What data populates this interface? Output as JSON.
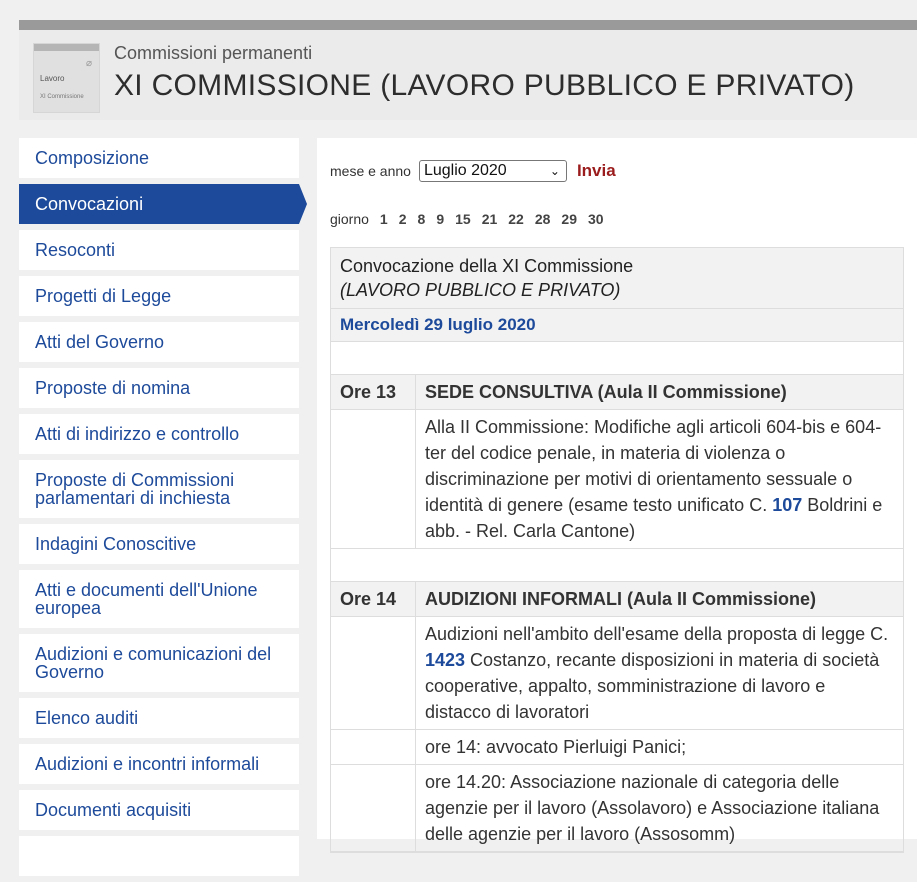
{
  "header": {
    "thumb_title": "Lavoro",
    "thumb_sub": "XI Commissione",
    "subtitle": "Commissioni permanenti",
    "title": "XI COMMISSIONE (LAVORO PUBBLICO E PRIVATO)"
  },
  "sidebar": {
    "items": [
      {
        "label": "Composizione"
      },
      {
        "label": "Convocazioni"
      },
      {
        "label": "Resoconti"
      },
      {
        "label": "Progetti di Legge"
      },
      {
        "label": "Atti del Governo"
      },
      {
        "label": "Proposte di nomina"
      },
      {
        "label": "Atti di indirizzo e controllo"
      },
      {
        "label": "Proposte di Commissioni parlamentari di inchiesta"
      },
      {
        "label": "Indagini Conoscitive"
      },
      {
        "label": "Atti e documenti dell'Unione europea"
      },
      {
        "label": "Audizioni e comunicazioni del Governo"
      },
      {
        "label": "Elenco auditi"
      },
      {
        "label": "Audizioni e incontri informali"
      },
      {
        "label": "Documenti acquisiti"
      }
    ]
  },
  "filter": {
    "label": "mese e anno",
    "selected": "Luglio 2020",
    "submit": "Invia"
  },
  "days": {
    "label": "giorno",
    "list": [
      "1",
      "2",
      "8",
      "9",
      "15",
      "21",
      "22",
      "28",
      "29",
      "30"
    ]
  },
  "convocazione": {
    "title": "Convocazione della XI Commissione",
    "subtitle": "(LAVORO PUBBLICO E PRIVATO)",
    "date": "Mercoledì 29 luglio 2020",
    "s1_time": "Ore 13",
    "s1_title": "SEDE CONSULTIVA (Aula II Commissione)",
    "s1_pre": "Alla II Commissione: Modifiche agli articoli 604-bis e 604-ter del codice penale, in materia di violenza o discriminazione per motivi di orientamento sessuale o identità di genere (esame testo unificato C. ",
    "s1_num": "107",
    "s1_post": " Boldrini e abb. - Rel. Carla Cantone)",
    "s2_time": "Ore 14",
    "s2_title": "AUDIZIONI INFORMALI (Aula II Commissione)",
    "s2_pre": "Audizioni nell'ambito dell'esame della proposta di legge C. ",
    "s2_num": "1423",
    "s2_post": " Costanzo, recante disposizioni in materia di società cooperative, appalto, somministrazione di lavoro e distacco di lavoratori",
    "s2_item1": "ore 14: avvocato Pierluigi Panici;",
    "s2_item2": "ore 14.20: Associazione nazionale di categoria delle agenzie per il lavoro (Assolavoro) e Associazione italiana delle agenzie per il lavoro (Assosomm)"
  }
}
